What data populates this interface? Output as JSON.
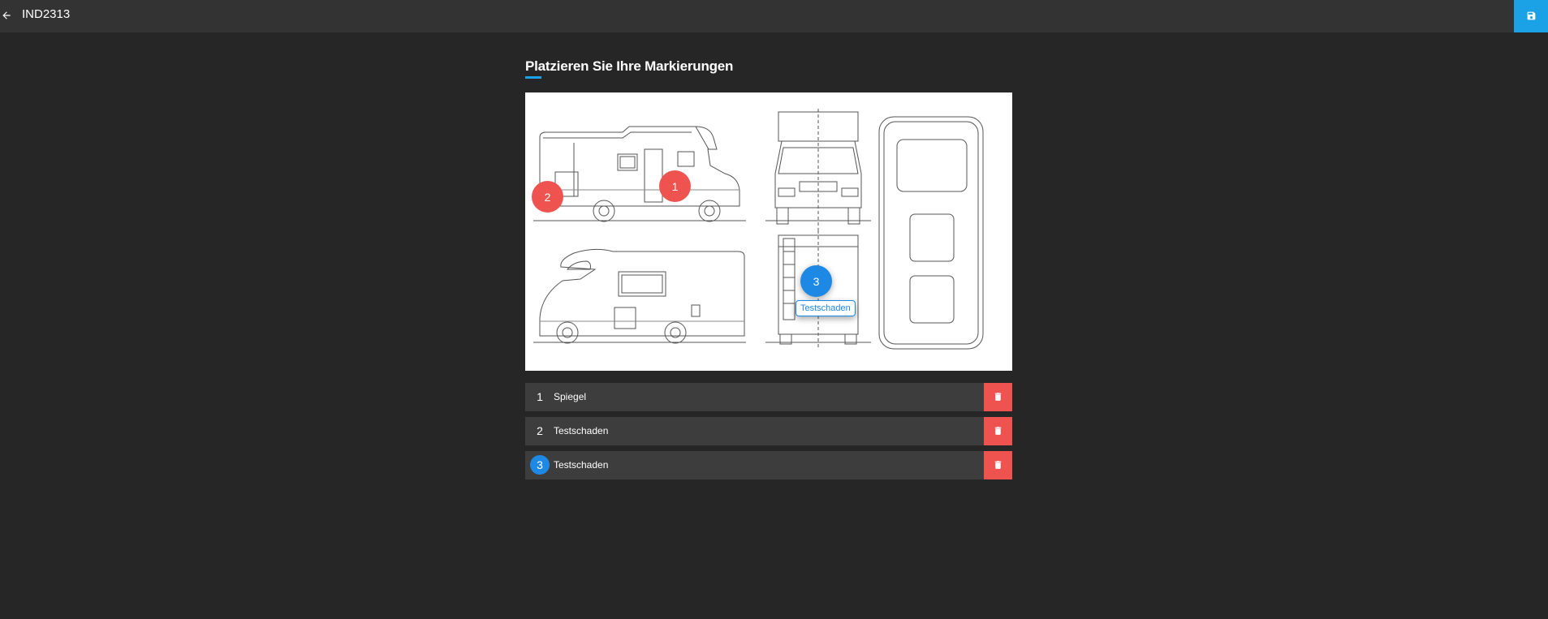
{
  "header": {
    "title": "IND2313",
    "back_icon": "arrow-left-icon",
    "save_icon": "floppy-disk-icon",
    "accent_color": "#1ba1e6"
  },
  "main": {
    "heading": "Platzieren Sie Ihre Markierungen"
  },
  "markers": [
    {
      "number": "1",
      "color": "#ef5350"
    },
    {
      "number": "2",
      "color": "#ef5350"
    },
    {
      "number": "3",
      "color": "#1e88e5",
      "selected": true
    }
  ],
  "tooltip": {
    "text": "Testschaden"
  },
  "damage_list": [
    {
      "number": "1",
      "label": "Spiegel",
      "delete_icon": "trash-icon"
    },
    {
      "number": "2",
      "label": "Testschaden",
      "delete_icon": "trash-icon"
    },
    {
      "number": "3",
      "label": "Testschaden",
      "delete_icon": "trash-icon",
      "active": true
    }
  ],
  "colors": {
    "delete": "#ef5350",
    "selected": "#1e88e5",
    "background": "#262626",
    "topbar": "#333333",
    "row": "#3d3d3d"
  }
}
